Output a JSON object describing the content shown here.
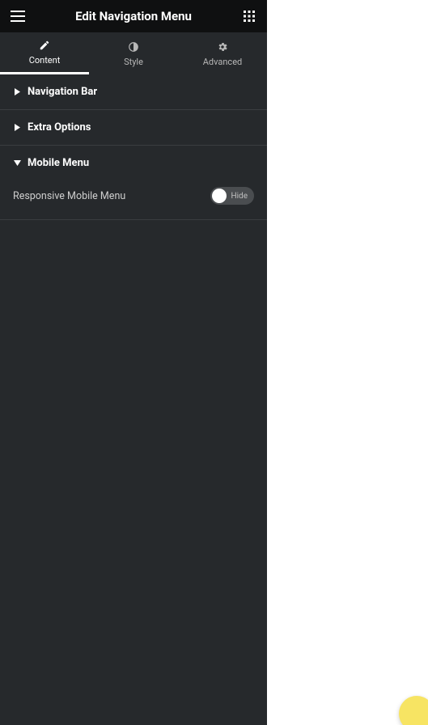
{
  "header": {
    "title": "Edit Navigation Menu"
  },
  "tabs": [
    {
      "label": "Content",
      "icon": "pencil",
      "active": true
    },
    {
      "label": "Style",
      "icon": "contrast",
      "active": false
    },
    {
      "label": "Advanced",
      "icon": "gear",
      "active": false
    }
  ],
  "sections": {
    "navigation_bar": {
      "title": "Navigation Bar",
      "expanded": false
    },
    "extra_options": {
      "title": "Extra Options",
      "expanded": false
    },
    "mobile_menu": {
      "title": "Mobile Menu",
      "expanded": true,
      "controls": {
        "responsive_mobile_menu": {
          "label": "Responsive Mobile Menu",
          "toggle_state_label": "Hide",
          "value": false
        }
      }
    }
  }
}
